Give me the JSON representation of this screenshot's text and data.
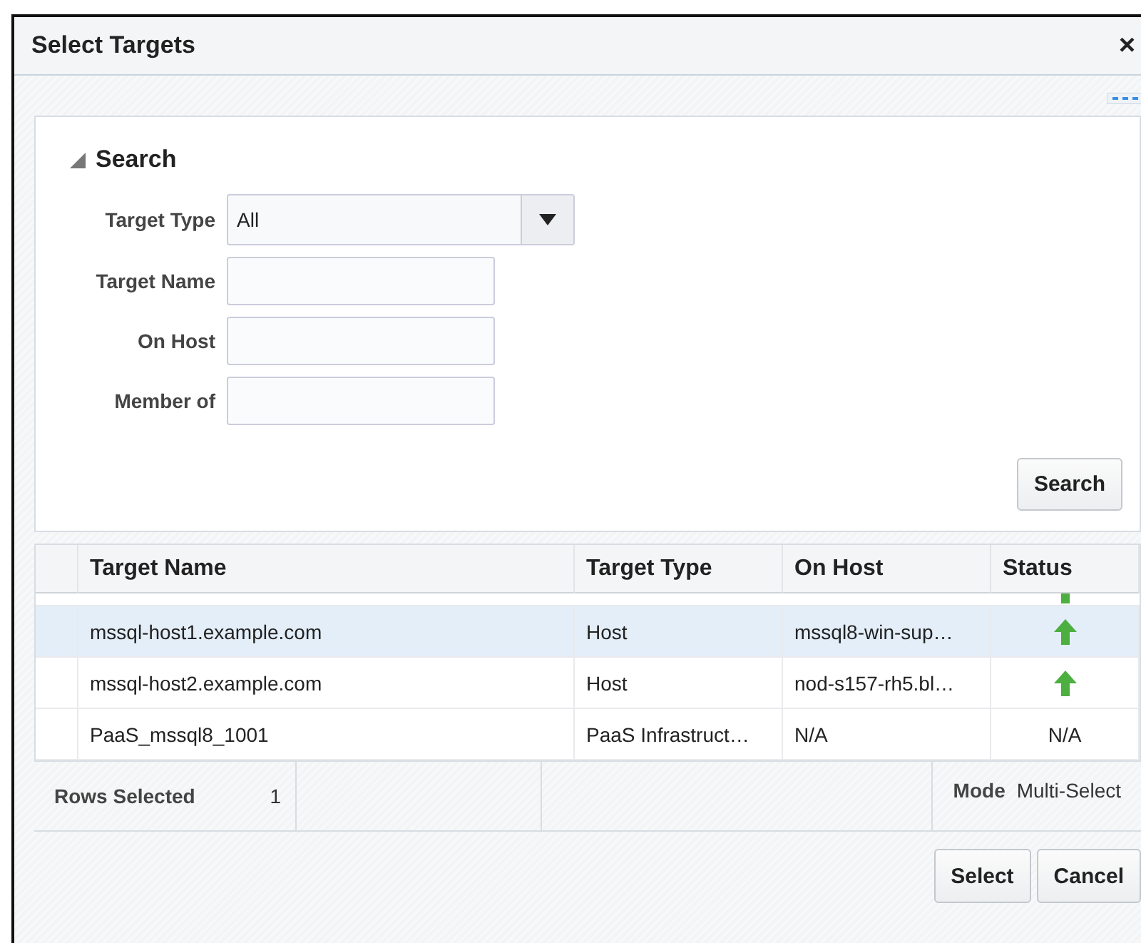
{
  "window": {
    "title": "Select Targets",
    "close": "×"
  },
  "search": {
    "title": "Search",
    "expanded": true,
    "fields": [
      {
        "label": "Target Type",
        "kind": "select",
        "value": "All"
      },
      {
        "label": "Target Name",
        "kind": "text"
      },
      {
        "label": "On Host",
        "kind": "text"
      },
      {
        "label": "Member of",
        "kind": "text"
      }
    ],
    "button": "Search"
  },
  "table": {
    "columns": [
      "Target Name",
      "Target Type",
      "On Host",
      "Status"
    ],
    "rows": [
      {
        "selected": true,
        "cells": [
          "mssql-host1.example.com",
          "Host",
          "mssql8-win-sup…"
        ],
        "status": {
          "kind": "up"
        }
      },
      {
        "selected": false,
        "cells": [
          "mssql-host2.example.com",
          "Host",
          "nod-s157-rh5.bl…"
        ],
        "status": {
          "kind": "up"
        }
      },
      {
        "selected": false,
        "cells": [
          "PaaS_mssql8_1001",
          "PaaS Infrastruct…",
          "N/A"
        ],
        "status": {
          "kind": "text",
          "text": "N/A"
        }
      }
    ]
  },
  "footer": {
    "rows_selected_label": "Rows Selected",
    "rows_selected": "1",
    "mode_label": "Mode",
    "mode": "Multi-Select"
  },
  "buttons": [
    "Select",
    "Cancel"
  ]
}
